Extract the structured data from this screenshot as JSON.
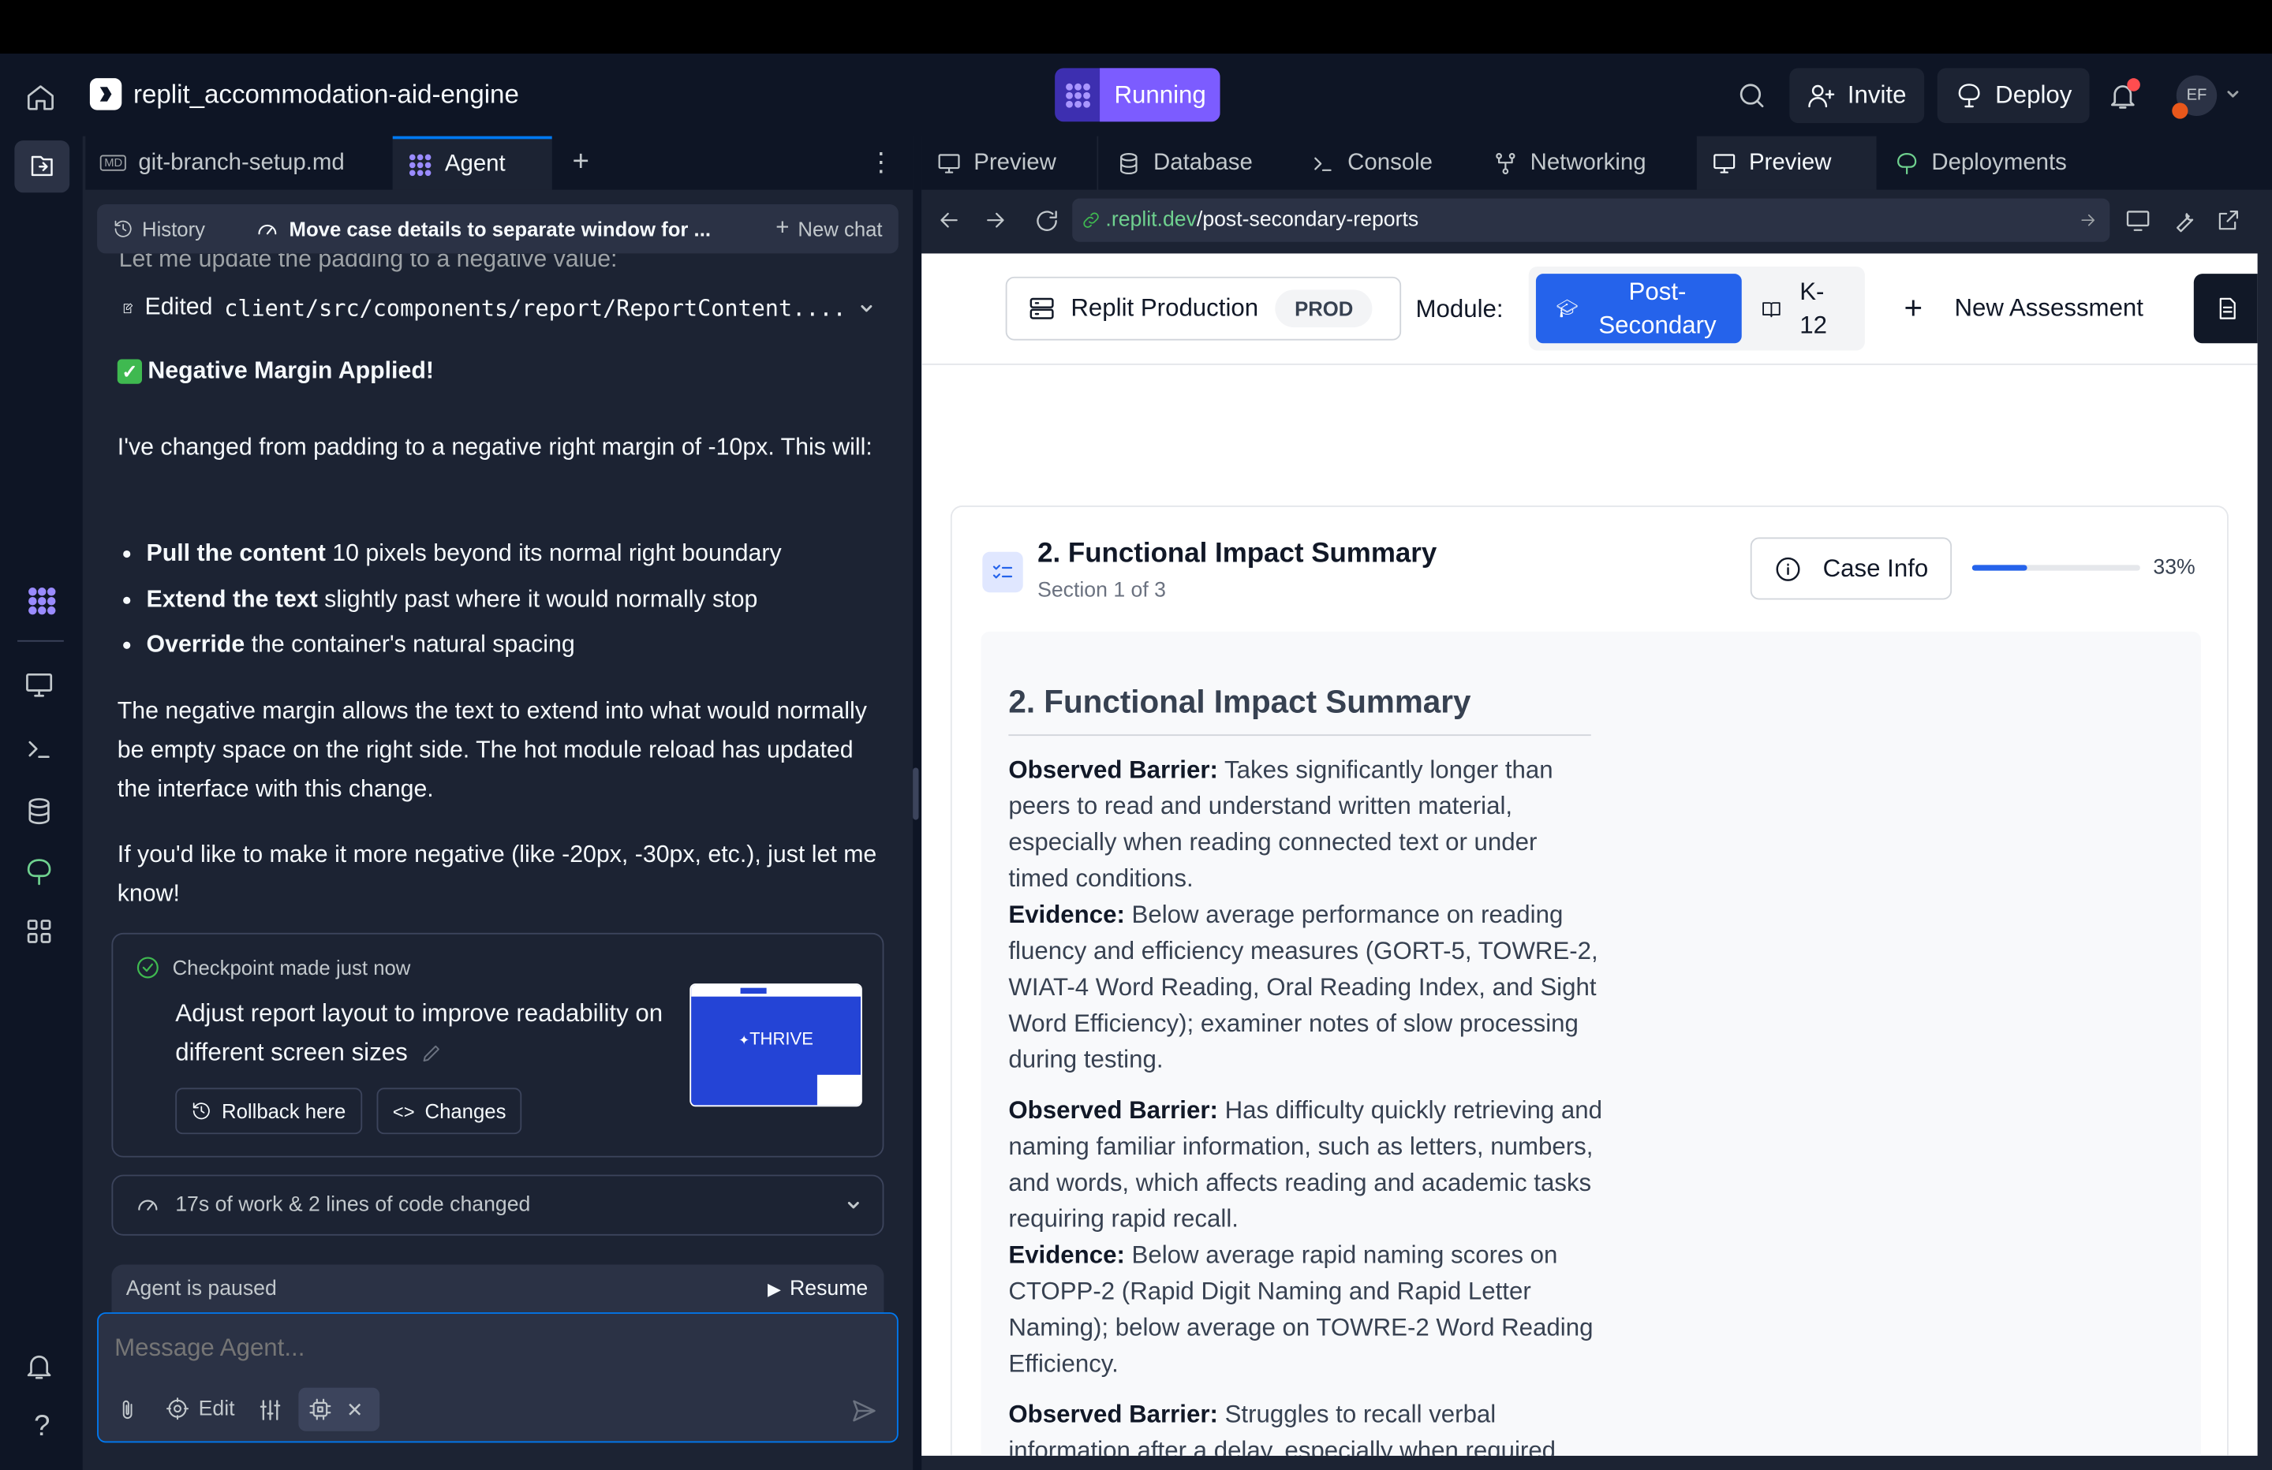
{
  "topbar": {
    "project_name": "replit_accommodation-aid-engine",
    "run_label": "Running",
    "invite_label": "Invite",
    "deploy_label": "Deploy",
    "avatar_initials": "EF"
  },
  "left_tabs": {
    "file_tab": "git-branch-setup.md",
    "file_badge": "MD",
    "agent_tab": "Agent"
  },
  "chat_header": {
    "history_label": "History",
    "chat_title": "Move case details to separate window for ...",
    "new_chat_label": "New chat"
  },
  "chat": {
    "cut_line": "Let me update the padding to a negative value:",
    "edited_prefix": "Edited",
    "edited_file": "client/src/components/report/ReportContent....",
    "heading_emoji": "✅",
    "heading": "Negative Margin Applied!",
    "para1": "I've changed from padding to a negative right margin of -10px. This will:",
    "bullets": [
      {
        "bold": "Pull the content",
        "rest": " 10 pixels beyond its normal right boundary"
      },
      {
        "bold": "Extend the text",
        "rest": " slightly past where it would normally stop"
      },
      {
        "bold": "Override",
        "rest": " the container's natural spacing"
      }
    ],
    "para2": "The negative margin allows the text to extend into what would normally be empty space on the right side. The hot module reload has updated the interface with this change.",
    "para3": "If you'd like to make it more negative (like -20px, -30px, etc.), just let me know!"
  },
  "checkpoint": {
    "label": "Checkpoint made",
    "time": "just now",
    "description": "Adjust report layout to improve readability on different screen sizes",
    "rollback_label": "Rollback here",
    "changes_label": "Changes",
    "thumb_text": "THRIVE"
  },
  "work_summary": "17s of work & 2 lines of code changed",
  "agent_status": {
    "paused_label": "Agent is paused",
    "resume_label": "Resume"
  },
  "composer": {
    "placeholder": "Message Agent...",
    "edit_label": "Edit"
  },
  "right_tabs": [
    "Preview",
    "Database",
    "Console",
    "Networking",
    "Preview",
    "Deployments"
  ],
  "url": {
    "domain": ".replit.dev",
    "path": "/post-secondary-reports"
  },
  "app_header": {
    "env_name": "Replit Production",
    "env_badge": "PROD",
    "module_label": "Module:",
    "module_active_line1": "Post-",
    "module_active_line2": "Secondary",
    "module_other_line1": "K-",
    "module_other_line2": "12",
    "new_assessment": "New Assessment"
  },
  "report": {
    "section_title": "2. Functional Impact Summary",
    "section_sub": "Section 1 of 3",
    "case_info_label": "Case Info",
    "progress_percent": 33,
    "progress_text": "33%",
    "content_title": "2. Functional Impact Summary",
    "blocks": [
      {
        "label": "Observed Barrier:",
        "text": " Takes significantly longer than peers to read and understand written material, especially when reading connected text or under timed conditions.",
        "ev_label": "Evidence:",
        "ev_text": " Below average performance on reading fluency and efficiency measures (GORT-5, TOWRE-2, WIAT-4 Word Reading, Oral Reading Index, and Sight Word Efficiency); examiner notes of slow processing during testing."
      },
      {
        "label": "Observed Barrier:",
        "text": " Has difficulty quickly retrieving and naming familiar information, such as letters, numbers, and words, which affects reading and academic tasks requiring rapid recall.",
        "ev_label": "Evidence:",
        "ev_text": " Below average rapid naming scores on CTOPP-2 (Rapid Digit Naming and Rapid Letter Naming); below average on TOWRE-2 Word Reading Efficiency."
      },
      {
        "label": "Observed Barrier:",
        "text": " Struggles to recall verbal information after a delay, especially when required"
      }
    ]
  },
  "colors": {
    "accent": "#7c5cff",
    "primary_blue": "#2563eb",
    "ide_bg": "#0e1525",
    "panel_bg": "#1c2333"
  }
}
